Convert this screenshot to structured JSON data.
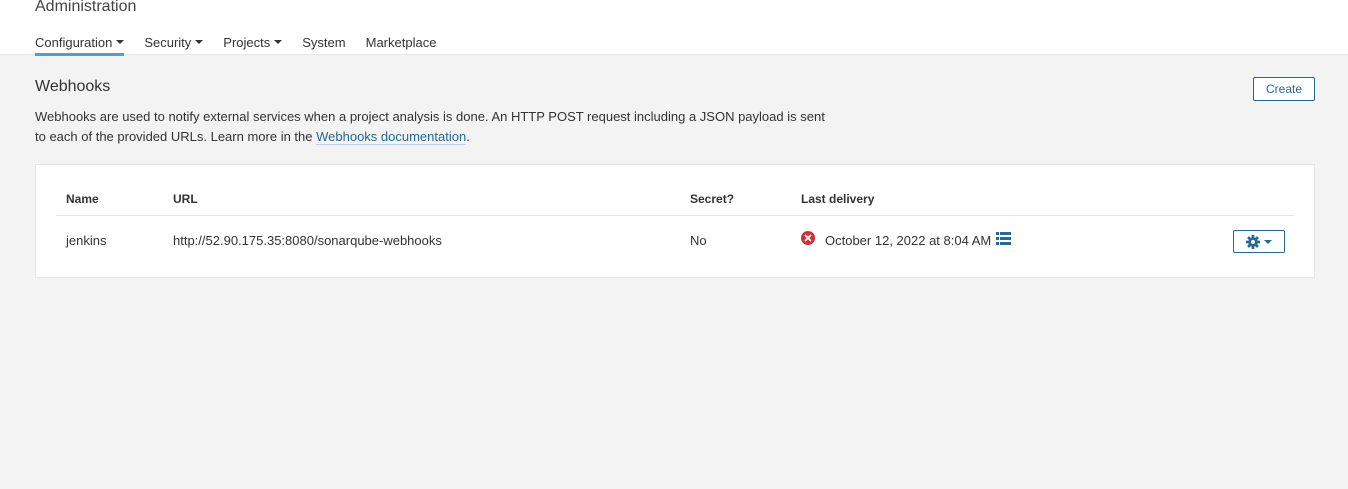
{
  "header": {
    "title": "Administration",
    "nav": [
      {
        "label": "Configuration",
        "has_dropdown": true,
        "active": true
      },
      {
        "label": "Security",
        "has_dropdown": true
      },
      {
        "label": "Projects",
        "has_dropdown": true
      },
      {
        "label": "System",
        "has_dropdown": false
      },
      {
        "label": "Marketplace",
        "has_dropdown": false
      }
    ]
  },
  "page": {
    "title": "Webhooks",
    "description_prefix": "Webhooks are used to notify external services when a project analysis is done. An HTTP POST request including a JSON payload is sent to each of the provided URLs. Learn more in the ",
    "doc_link": "Webhooks documentation",
    "description_suffix": ".",
    "create_label": "Create"
  },
  "table": {
    "columns": [
      "Name",
      "URL",
      "Secret?",
      "Last delivery"
    ],
    "rows": [
      {
        "name": "jenkins",
        "url": "http://52.90.175.35:8080/sonarqube-webhooks",
        "secret": "No",
        "last_delivery": "October 12, 2022 at 8:04 AM",
        "delivery_status": "error"
      }
    ]
  },
  "colors": {
    "accent": "#236a97",
    "active_tab": "#4b9fd5",
    "error": "#d02f3a"
  },
  "icons": [
    "caret-down-icon",
    "error-icon",
    "list-icon",
    "gear-icon"
  ]
}
